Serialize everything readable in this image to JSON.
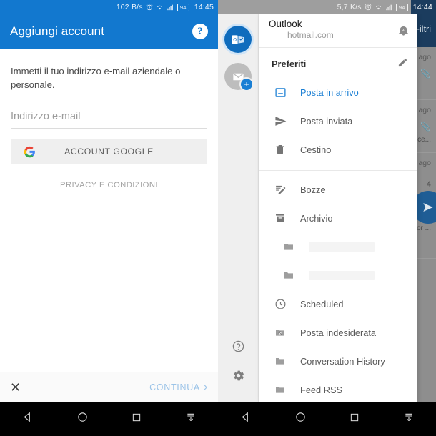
{
  "left_phone": {
    "statusbar": {
      "net_speed": "102 B/s",
      "alarm_icon": "alarm-icon",
      "wifi_icon": "wifi-icon",
      "signal_icon": "signal-icon",
      "battery": "94",
      "time": "14:45"
    },
    "appbar": {
      "title": "Aggiungi account",
      "help_label": "?"
    },
    "intro_text": "Immetti il tuo indirizzo e-mail aziendale o personale.",
    "email_field": {
      "value": "",
      "placeholder": "Indirizzo e-mail"
    },
    "google_button": {
      "label": "ACCOUNT GOOGLE",
      "icon": "google-g-icon"
    },
    "privacy_link": "PRIVACY E CONDIZIONI",
    "bottom_bar": {
      "close_label": "✕",
      "continue_label": "CONTINUA",
      "continue_chevron": "›"
    },
    "navbar": {
      "back": "back-triangle-icon",
      "home": "home-circle-icon",
      "recents": "recents-square-icon",
      "extra": "download-arrow-icon"
    }
  },
  "right_phone": {
    "statusbar": {
      "net_speed": "5,7 K/s",
      "alarm_icon": "alarm-icon",
      "wifi_icon": "wifi-icon",
      "signal_icon": "signal-icon",
      "battery": "94",
      "time": "14:44"
    },
    "background": {
      "filters_label": "Filtri",
      "rows": [
        {
          "time": "ago",
          "attachment": "attachment-icon",
          "snippet": ""
        },
        {
          "time": "ago",
          "attachment": "attachment-icon",
          "snippet": "ce..."
        },
        {
          "time": "ago",
          "attachment": "",
          "snippet": "4"
        },
        {
          "time": "ago",
          "attachment": "",
          "snippet": "or ..."
        }
      ],
      "fab": "compose-fab"
    },
    "rail": {
      "accounts": [
        {
          "name": "outlook-account-avatar",
          "selected": true
        },
        {
          "name": "add-account-avatar",
          "badge": "+",
          "selected": false
        }
      ],
      "help_icon": "help-circle-icon",
      "settings_icon": "gear-icon"
    },
    "drawer": {
      "account": {
        "name": "Outlook",
        "email": "hotmail.com",
        "bell_icon": "bell-snooze-icon"
      },
      "section_title": "Preferiti",
      "edit_icon": "pencil-icon",
      "favorites": [
        {
          "label": "Posta in arrivo",
          "icon": "inbox-icon",
          "active": true
        },
        {
          "label": "Posta inviata",
          "icon": "sent-paperplane-icon",
          "active": false
        },
        {
          "label": "Cestino",
          "icon": "trash-icon",
          "active": false
        }
      ],
      "folders": [
        {
          "label": "Bozze",
          "icon": "drafts-pencil-icon",
          "active": false,
          "indent": false
        },
        {
          "label": "Archivio",
          "icon": "archive-icon",
          "active": false,
          "indent": false
        },
        {
          "label": "",
          "icon": "folder-icon",
          "active": false,
          "indent": true
        },
        {
          "label": "",
          "icon": "folder-icon",
          "active": false,
          "indent": true
        },
        {
          "label": "Scheduled",
          "icon": "clock-icon",
          "active": false,
          "indent": false
        },
        {
          "label": "Posta indesiderata",
          "icon": "junk-folder-icon",
          "active": false,
          "indent": false
        },
        {
          "label": "Conversation History",
          "icon": "folder-icon",
          "active": false,
          "indent": false
        },
        {
          "label": "Feed RSS",
          "icon": "folder-icon",
          "active": false,
          "indent": false
        }
      ]
    },
    "navbar": {
      "back": "back-triangle-icon",
      "home": "home-circle-icon",
      "recents": "recents-square-icon",
      "extra": "download-arrow-icon"
    }
  },
  "colors": {
    "accent_blue": "#1278cf",
    "outlook_blue": "#0f6cbd",
    "link_blue": "#1a7fd4",
    "header_navy": "#1b3c5e"
  }
}
